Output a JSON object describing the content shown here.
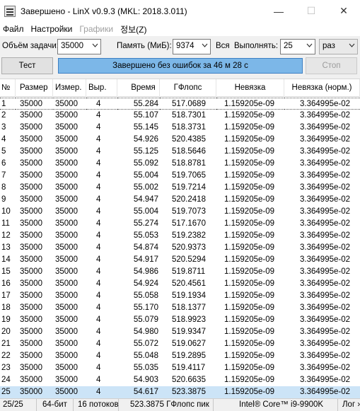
{
  "window": {
    "title": "Завершено - LinX v0.9.3 (MKL: 2018.3.011)",
    "minimize": "—",
    "maximize": "☐",
    "close": "✕"
  },
  "menu": {
    "file": "Файл",
    "settings": "Настройки",
    "graphs": "Графики",
    "info": "정보(Z)"
  },
  "controls": {
    "problem_size_label": "Объём задачи:",
    "problem_size_value": "35000",
    "memory_label": "Память (МиБ):",
    "memory_value": "9374",
    "all_label": "Вся",
    "run_label": "Выполнять:",
    "run_value": "25",
    "unit_value": "раз"
  },
  "buttons": {
    "test": "Тест",
    "stop": "Стоп"
  },
  "progress": {
    "text": "Завершено без ошибок за 46 м 28 с",
    "fraction": 1.0
  },
  "table": {
    "columns": [
      "№",
      "Размер",
      "Измер.",
      "Выр.",
      "Время",
      "ГФлопс",
      "Невязка",
      "Невязка (норм.)"
    ],
    "rows": [
      [
        "1",
        "35000",
        "35000",
        "4",
        "55.284",
        "517.0689",
        "1.159205e-09",
        "3.364995e-02"
      ],
      [
        "2",
        "35000",
        "35000",
        "4",
        "55.107",
        "518.7301",
        "1.159205e-09",
        "3.364995e-02"
      ],
      [
        "3",
        "35000",
        "35000",
        "4",
        "55.145",
        "518.3731",
        "1.159205e-09",
        "3.364995e-02"
      ],
      [
        "4",
        "35000",
        "35000",
        "4",
        "54.926",
        "520.4385",
        "1.159205e-09",
        "3.364995e-02"
      ],
      [
        "5",
        "35000",
        "35000",
        "4",
        "55.125",
        "518.5646",
        "1.159205e-09",
        "3.364995e-02"
      ],
      [
        "6",
        "35000",
        "35000",
        "4",
        "55.092",
        "518.8781",
        "1.159205e-09",
        "3.364995e-02"
      ],
      [
        "7",
        "35000",
        "35000",
        "4",
        "55.004",
        "519.7065",
        "1.159205e-09",
        "3.364995e-02"
      ],
      [
        "8",
        "35000",
        "35000",
        "4",
        "55.002",
        "519.7214",
        "1.159205e-09",
        "3.364995e-02"
      ],
      [
        "9",
        "35000",
        "35000",
        "4",
        "54.947",
        "520.2418",
        "1.159205e-09",
        "3.364995e-02"
      ],
      [
        "10",
        "35000",
        "35000",
        "4",
        "55.004",
        "519.7073",
        "1.159205e-09",
        "3.364995e-02"
      ],
      [
        "11",
        "35000",
        "35000",
        "4",
        "55.274",
        "517.1670",
        "1.159205e-09",
        "3.364995e-02"
      ],
      [
        "12",
        "35000",
        "35000",
        "4",
        "55.053",
        "519.2382",
        "1.159205e-09",
        "3.364995e-02"
      ],
      [
        "13",
        "35000",
        "35000",
        "4",
        "54.874",
        "520.9373",
        "1.159205e-09",
        "3.364995e-02"
      ],
      [
        "14",
        "35000",
        "35000",
        "4",
        "54.917",
        "520.5294",
        "1.159205e-09",
        "3.364995e-02"
      ],
      [
        "15",
        "35000",
        "35000",
        "4",
        "54.986",
        "519.8711",
        "1.159205e-09",
        "3.364995e-02"
      ],
      [
        "16",
        "35000",
        "35000",
        "4",
        "54.924",
        "520.4561",
        "1.159205e-09",
        "3.364995e-02"
      ],
      [
        "17",
        "35000",
        "35000",
        "4",
        "55.058",
        "519.1934",
        "1.159205e-09",
        "3.364995e-02"
      ],
      [
        "18",
        "35000",
        "35000",
        "4",
        "55.170",
        "518.1377",
        "1.159205e-09",
        "3.364995e-02"
      ],
      [
        "19",
        "35000",
        "35000",
        "4",
        "55.079",
        "518.9923",
        "1.159205e-09",
        "3.364995e-02"
      ],
      [
        "20",
        "35000",
        "35000",
        "4",
        "54.980",
        "519.9347",
        "1.159205e-09",
        "3.364995e-02"
      ],
      [
        "21",
        "35000",
        "35000",
        "4",
        "55.072",
        "519.0627",
        "1.159205e-09",
        "3.364995e-02"
      ],
      [
        "22",
        "35000",
        "35000",
        "4",
        "55.048",
        "519.2895",
        "1.159205e-09",
        "3.364995e-02"
      ],
      [
        "23",
        "35000",
        "35000",
        "4",
        "55.035",
        "519.4117",
        "1.159205e-09",
        "3.364995e-02"
      ],
      [
        "24",
        "35000",
        "35000",
        "4",
        "54.903",
        "520.6635",
        "1.159205e-09",
        "3.364995e-02"
      ],
      [
        "25",
        "35000",
        "35000",
        "4",
        "54.617",
        "523.3875",
        "1.159205e-09",
        "3.364995e-02"
      ]
    ]
  },
  "statusbar": {
    "progress": "25/25",
    "bits": "64-бит",
    "threads": "16 потоков",
    "peak": "523.3875 ГФлопс пик",
    "cpu": "Intel® Core™ i9-9900K",
    "log": "Лог ›"
  },
  "colors": {
    "progress_fill": "#7cb7e8",
    "selection": "#cce4f7"
  }
}
